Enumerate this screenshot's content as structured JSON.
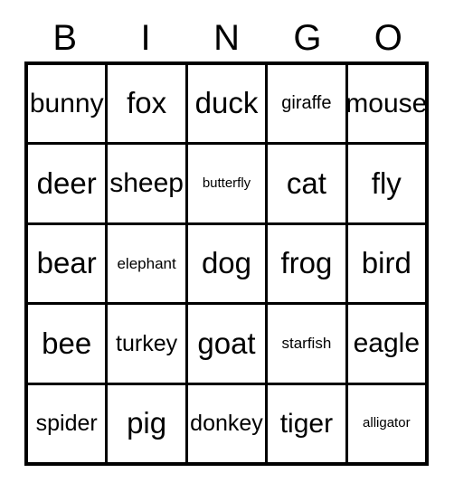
{
  "card": {
    "title": "BINGO",
    "theme_colors": {
      "ink": "#000000",
      "paper": "#ffffff"
    },
    "header": {
      "letters": [
        "B",
        "I",
        "N",
        "G",
        "O"
      ]
    },
    "grid": {
      "rows": 5,
      "columns": 5,
      "cells": [
        [
          {
            "text": "bunny"
          },
          {
            "text": "fox"
          },
          {
            "text": "duck"
          },
          {
            "text": "giraffe"
          },
          {
            "text": "mouse"
          }
        ],
        [
          {
            "text": "deer"
          },
          {
            "text": "sheep"
          },
          {
            "text": "butterfly"
          },
          {
            "text": "cat"
          },
          {
            "text": "fly"
          }
        ],
        [
          {
            "text": "bear"
          },
          {
            "text": "elephant"
          },
          {
            "text": "dog"
          },
          {
            "text": "frog"
          },
          {
            "text": "bird"
          }
        ],
        [
          {
            "text": "bee"
          },
          {
            "text": "turkey"
          },
          {
            "text": "goat"
          },
          {
            "text": "starfish"
          },
          {
            "text": "eagle"
          }
        ],
        [
          {
            "text": "spider"
          },
          {
            "text": "pig"
          },
          {
            "text": "donkey"
          },
          {
            "text": "tiger"
          },
          {
            "text": "alligator"
          }
        ]
      ]
    }
  }
}
